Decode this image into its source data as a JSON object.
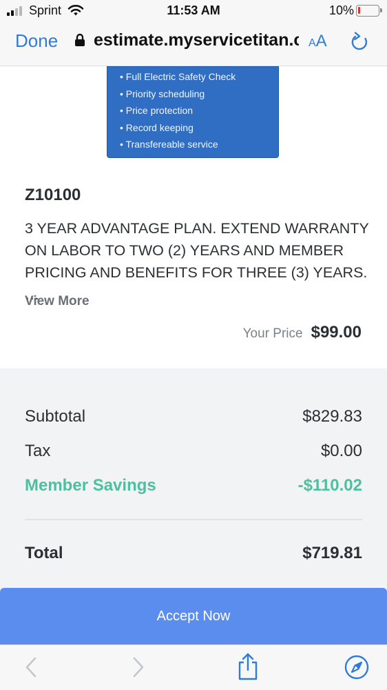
{
  "status_bar": {
    "carrier": "Sprint",
    "time": "11:53 AM",
    "battery": "10%",
    "battery_level": 0.1
  },
  "browser": {
    "done_label": "Done",
    "url": "estimate.myservicetitan.com",
    "text_size_small": "A",
    "text_size_large": "A"
  },
  "promo": {
    "items": [
      "Full Electric Safety Check",
      "Priority scheduling",
      "Price protection",
      "Record keeping",
      "Transfereable service"
    ]
  },
  "item": {
    "code": "Z10100",
    "description": "3 YEAR ADVANTAGE PLAN. EXTEND WARRANTY ON LABOR TO TWO (2) YEARS AND MEMBER PRICING AND BENEFITS FOR THREE (3) YEARS. …",
    "view_more": "View More",
    "price_label": "Your Price",
    "price": "$99.00"
  },
  "summary": {
    "subtotal_label": "Subtotal",
    "subtotal": "$829.83",
    "tax_label": "Tax",
    "tax": "$0.00",
    "savings_label": "Member Savings",
    "savings": "-$110.02",
    "total_label": "Total",
    "total": "$719.81"
  },
  "accept_label": "Accept Now",
  "colors": {
    "accent": "#5b8def",
    "link": "#2f7bd8",
    "savings": "#4fbf9f",
    "promo_bg": "#2f6ec2"
  },
  "icons": {
    "back": "chevron-left-icon",
    "forward": "chevron-right-icon",
    "share": "share-icon",
    "bookmarks": "compass-icon",
    "reload": "reload-icon",
    "lock": "lock-icon"
  }
}
